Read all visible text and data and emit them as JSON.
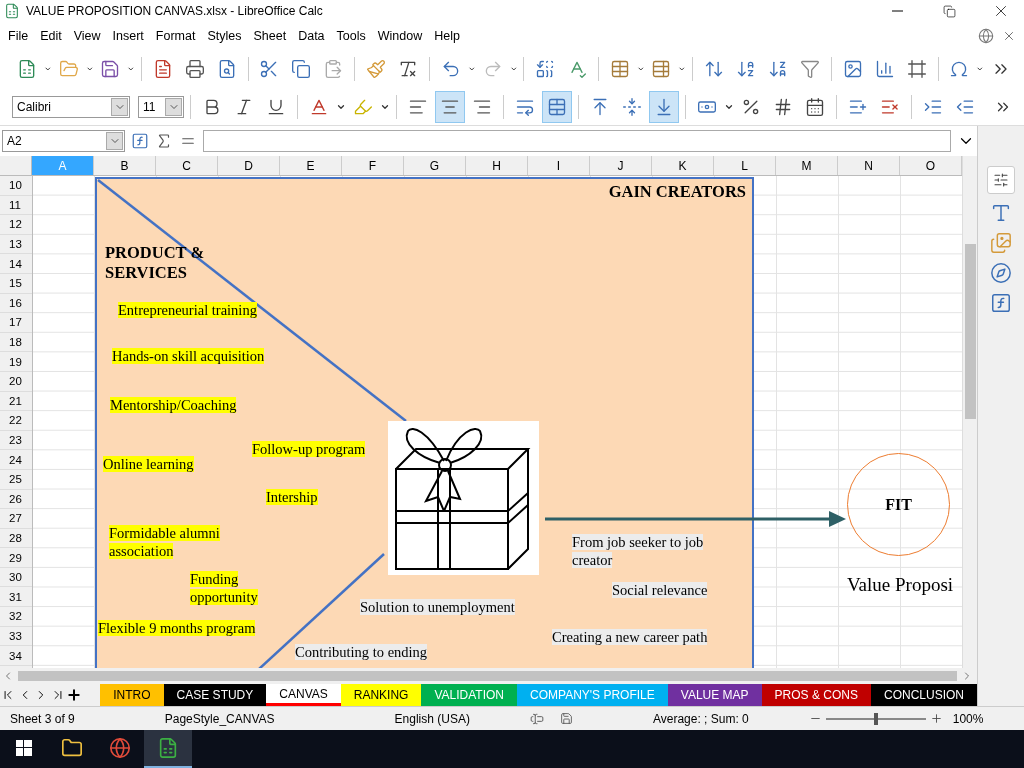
{
  "window": {
    "title": "VALUE PROPOSITION CANVAS.xlsx - LibreOffice Calc"
  },
  "menu": [
    "File",
    "Edit",
    "View",
    "Insert",
    "Format",
    "Styles",
    "Sheet",
    "Data",
    "Tools",
    "Window",
    "Help"
  ],
  "formatting_toolbar": {
    "font": "Calibri",
    "size": "11",
    "buttons": [
      {
        "on": false
      },
      {
        "on": false
      },
      {
        "on": false
      },
      {
        "on": false
      },
      {
        "on": false
      },
      {
        "on": false
      },
      {
        "on": true
      },
      {
        "on": false
      },
      {
        "on": false
      },
      {
        "on": true
      },
      {
        "on": false
      },
      {
        "on": false
      },
      {
        "on": true
      },
      {
        "on": false
      },
      {
        "on": false
      },
      {
        "on": false
      },
      {
        "on": false
      },
      {
        "on": false
      },
      {
        "on": false
      },
      {
        "on": false
      },
      {
        "on": false
      }
    ]
  },
  "formula_bar": {
    "name_box": "A2"
  },
  "columns": [
    {
      "label": "A",
      "selected": true
    },
    {
      "label": "B",
      "selected": false
    },
    {
      "label": "C",
      "selected": false
    },
    {
      "label": "D",
      "selected": false
    },
    {
      "label": "E",
      "selected": false
    },
    {
      "label": "F",
      "selected": false
    },
    {
      "label": "G",
      "selected": false
    },
    {
      "label": "H",
      "selected": false
    },
    {
      "label": "I",
      "selected": false
    },
    {
      "label": "J",
      "selected": false
    },
    {
      "label": "K",
      "selected": false
    },
    {
      "label": "L",
      "selected": false
    },
    {
      "label": "M",
      "selected": false
    },
    {
      "label": "N",
      "selected": false
    },
    {
      "label": "O",
      "selected": false
    }
  ],
  "rows": [
    "10",
    "11",
    "12",
    "13",
    "14",
    "15",
    "16",
    "17",
    "18",
    "19",
    "20",
    "21",
    "22",
    "23",
    "24",
    "25",
    "26",
    "27",
    "28",
    "29",
    "30",
    "31",
    "32",
    "33",
    "34"
  ],
  "canvas": {
    "gain_creators_title": "GAIN CREATORS",
    "products_title": "PRODUCT & SERVICES",
    "products_services": [
      {
        "text": "Entrepreneurial training ",
        "color": "#ffff00"
      },
      {
        "text": "Hands-on skill acquisition",
        "color": "#ffff00"
      },
      {
        "text": "Mentorship/Coaching",
        "color": "#ffff00"
      },
      {
        "text": "Follow-up program",
        "color": "#ffff00"
      },
      {
        "text": "Online learning",
        "color": "#ffff00"
      },
      {
        "text": "Intership",
        "color": "#ffff00"
      },
      {
        "text": "Formidable alumni association",
        "color": "#ffff00"
      },
      {
        "text": "Funding opportunity",
        "color": "#ffff00"
      },
      {
        "text": "Flexible 9 months program",
        "color": "#ffff00"
      }
    ],
    "gain_creators": [
      {
        "text": "From job seeker to job creator",
        "color": "#ececec"
      },
      {
        "text": "Social relevance",
        "color": "#ececec"
      },
      {
        "text": "Solution to unemployment",
        "color": "#ececec"
      },
      {
        "text": "Creating a new career path",
        "color": "#ececec"
      },
      {
        "text": "Contributing to ending",
        "color": "#ececec"
      }
    ],
    "fit_label": "FIT",
    "value_proposition_label": "Value Proposi"
  },
  "sheet_tabs": [
    {
      "label": "INTRO",
      "color": "#ffc000",
      "selected": false
    },
    {
      "label": "CASE STUDY",
      "color": "#000000",
      "selected": false
    },
    {
      "label": "CANVAS",
      "color": "#ff0000",
      "selected": true
    },
    {
      "label": "RANKING",
      "color": "#ffff00",
      "selected": false
    },
    {
      "label": "VALIDATION",
      "color": "#00b050",
      "selected": false
    },
    {
      "label": "COMPANY'S PROFILE",
      "color": "#00b0f0",
      "selected": false
    },
    {
      "label": "VALUE MAP",
      "color": "#7030a0",
      "selected": false
    },
    {
      "label": "PROS & CONS",
      "color": "#c00000",
      "selected": false
    },
    {
      "label": "CONCLUSION",
      "color": "#000000",
      "selected": false
    }
  ],
  "status_bar": {
    "sheet": "Sheet 3 of 9",
    "page_style": "PageStyle_CANVAS",
    "language": "English (USA)",
    "summary": "Average: ; Sum: 0",
    "zoom": {
      "level": 0.5,
      "reading": "100%"
    }
  },
  "taskbar": [
    {
      "selected": false
    },
    {
      "selected": false
    },
    {
      "selected": true
    }
  ]
}
